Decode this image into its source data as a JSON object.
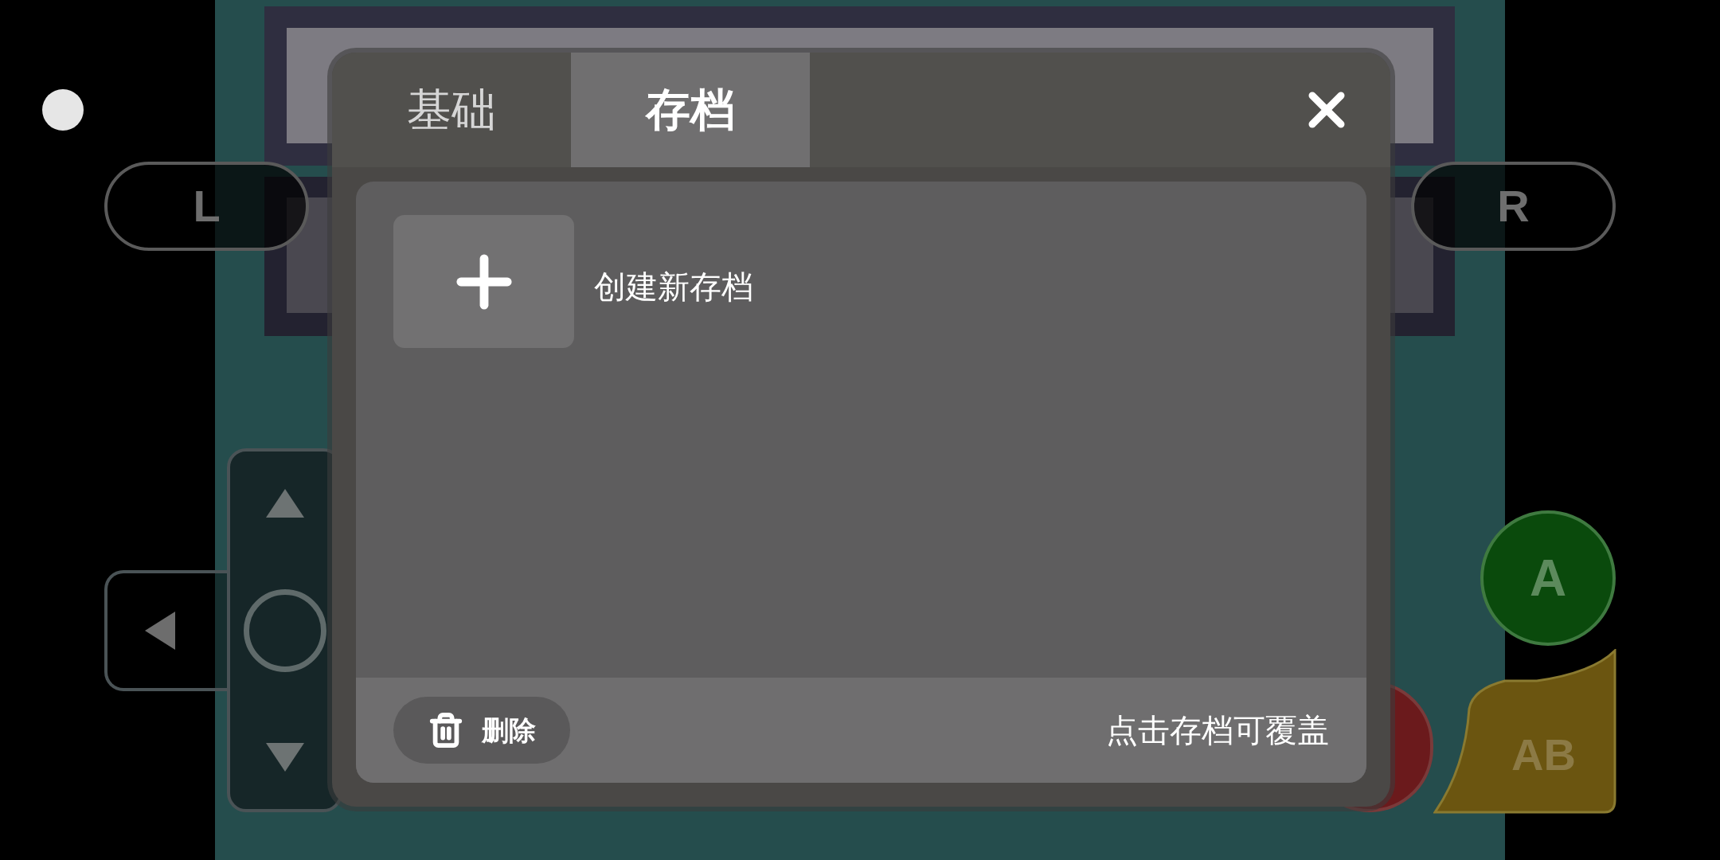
{
  "controls": {
    "l": "L",
    "r": "R",
    "a": "A",
    "ab": "AB"
  },
  "dialog": {
    "tabs": [
      {
        "label": "基础",
        "selected": false
      },
      {
        "label": "存档",
        "selected": true
      }
    ],
    "create_label": "创建新存档",
    "delete_button": "删除",
    "hint": "点击存档可覆盖"
  }
}
